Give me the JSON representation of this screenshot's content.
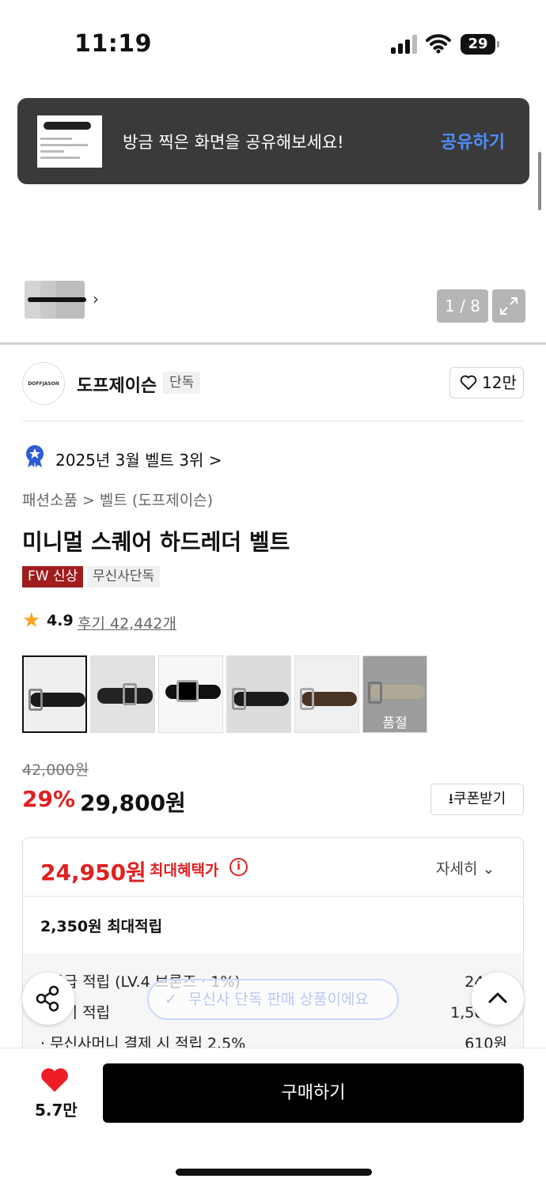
{
  "status_bar": {
    "time": "11:19",
    "battery": "29"
  },
  "toast": {
    "message": "방금 찍은 화면을 공유해보세요!",
    "action": "공유하기"
  },
  "gallery": {
    "counter": "1 / 8"
  },
  "brand": {
    "logo_text": "DOFFJASON",
    "name": "도프제이슨",
    "tag": "단독",
    "likes": "12만"
  },
  "ranking": {
    "text": "2025년 3월 벨트 3위",
    "chevron": ">"
  },
  "breadcrumb": "패션소품 > 벨트 (도프제이슨)",
  "product": {
    "title": "미니멀 스퀘어 하드레더 벨트",
    "tags": [
      "FW 신상",
      "무신사단독"
    ],
    "rating": "4.9",
    "reviews": "후기 42,442개",
    "swatches": [
      {
        "color": "#1a1a1a",
        "selected": true
      },
      {
        "color": "#222222"
      },
      {
        "color": "#111111"
      },
      {
        "color": "#1c1c1c"
      },
      {
        "color": "#4a3426"
      },
      {
        "color": "#b0a898",
        "soldout_label": "품절"
      }
    ]
  },
  "pricing": {
    "original": "42,000원",
    "discount": "29%",
    "price": "29,800원",
    "coupon_button": "쿠폰받기"
  },
  "benefits": {
    "max_price": "24,950원",
    "max_label": "최대혜택가",
    "info": "i",
    "detail": "자세히",
    "max_points": "2,350원 최대적립",
    "rows": [
      {
        "label": "· 등급 적립 (LV.4 브론즈 · 1%)",
        "value": "240원"
      },
      {
        "label": "· 후기 적립",
        "value": "1,500원"
      },
      {
        "label": "· 무신사머니 결제 시 적립 2.5%",
        "value": "610원"
      }
    ]
  },
  "exclusive_pill": "무신사 단독 판매 상품이에요",
  "bottom": {
    "likes": "5.7만",
    "buy_button": "구매하기"
  },
  "colors": {
    "accent_red": "#e02020",
    "brand_tag_red": "#a11d1d",
    "link_blue": "#4f8dff"
  }
}
